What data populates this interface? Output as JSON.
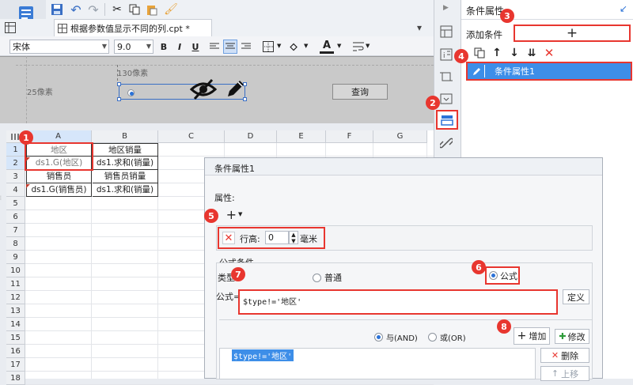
{
  "toolbar": {
    "icons": [
      "save-icon",
      "undo-icon",
      "redo-icon",
      "cut-icon",
      "copy-icon",
      "paste-icon",
      "format-painter-icon"
    ]
  },
  "file_tab": {
    "label": "根据参数值显示不同的列.cpt *"
  },
  "format_bar": {
    "font": "宋体",
    "size": "9.0",
    "bold": "B",
    "italic": "I",
    "underline": "U"
  },
  "design_band": {
    "ruler_h": "130像素",
    "ruler_v": "25像素",
    "query_button": "查询"
  },
  "grid": {
    "columns": [
      "A",
      "B",
      "C",
      "D",
      "E",
      "F",
      "G"
    ],
    "rows": [
      "1",
      "2",
      "3",
      "4",
      "5",
      "6",
      "7",
      "8",
      "9",
      "10",
      "11",
      "12",
      "13",
      "14",
      "15",
      "16",
      "17",
      "18"
    ],
    "cells": [
      {
        "A": "地区",
        "B": "地区销量"
      },
      {
        "A": "ds1.G(地区)",
        "B": "ds1.求和(销量)"
      },
      {
        "A": "销售员",
        "B": "销售员销量"
      },
      {
        "A": "ds1.G(销售员)",
        "B": "ds1.求和(销量)"
      }
    ]
  },
  "side_panel": {
    "title": "条件属性",
    "add_condition": "添加条件",
    "add_symbol": "+",
    "item": "条件属性1"
  },
  "dialog": {
    "title": "条件属性1",
    "attributes_label": "属性:",
    "row_height_label": "行高:",
    "row_height_value": "0",
    "unit": "毫米",
    "formula_condition_label": "公式条件",
    "type_label": "类型:",
    "radio_normal": "普通",
    "radio_formula": "公式",
    "formula_label": "公式=",
    "formula_value": "$type!='地区'",
    "define_button": "定义",
    "and_label": "与(AND)",
    "or_label": "或(OR)",
    "add_button": "增加",
    "modify_button": "修改",
    "delete_button": "删除",
    "moveup_button": "上移",
    "condition_item": "$type!='地区'"
  },
  "badges": [
    "1",
    "2",
    "3",
    "4",
    "5",
    "6",
    "7",
    "8"
  ],
  "colors": {
    "accent": "#2b72d7",
    "badge": "#e8362f",
    "selection": "#3d8ee8"
  }
}
